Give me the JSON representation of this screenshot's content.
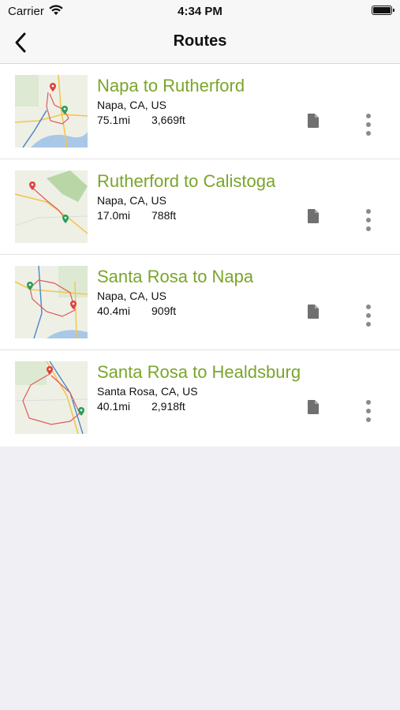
{
  "status_bar": {
    "carrier": "Carrier",
    "time": "4:34 PM"
  },
  "nav": {
    "title": "Routes",
    "back_icon": "chevron-left-icon"
  },
  "routes": [
    {
      "name": "Napa to Rutherford",
      "location": "Napa, CA, US",
      "distance": "75.1mi",
      "elevation": "3,669ft"
    },
    {
      "name": "Rutherford to Calistoga",
      "location": "Napa, CA, US",
      "distance": "17.0mi",
      "elevation": "788ft"
    },
    {
      "name": "Santa Rosa to Napa",
      "location": "Napa, CA, US",
      "distance": "40.4mi",
      "elevation": "909ft"
    },
    {
      "name": "Santa Rosa to Healdsburg",
      "location": "Santa Rosa, CA, US",
      "distance": "40.1mi",
      "elevation": "2,918ft"
    }
  ],
  "colors": {
    "accent_green": "#7aa52a",
    "start_pin": "#2a9d5a",
    "end_pin": "#e0403a",
    "route_line": "#e05a5a",
    "water": "#a9c8e8",
    "road": "#f2c64b"
  },
  "icons": {
    "row_doc": "document-icon",
    "row_more": "more-vertical-icon"
  }
}
